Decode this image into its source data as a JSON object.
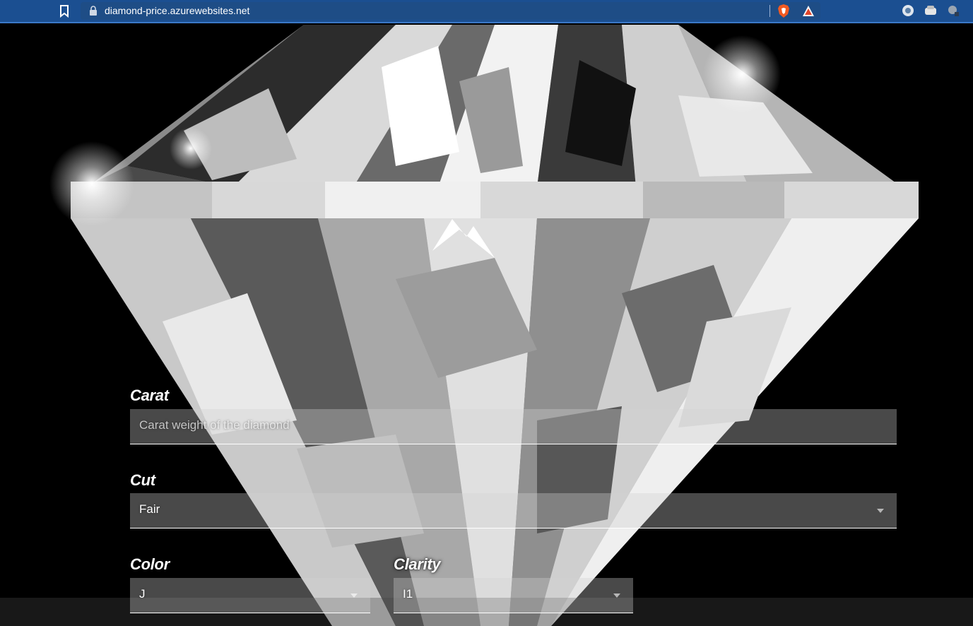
{
  "browser": {
    "url": "diamond-price.azurewebsites.net",
    "icons": [
      "bookmark-icon",
      "lock-icon",
      "brave-shield-icon",
      "brave-rewards-icon",
      "extension-icon",
      "extension-icon",
      "extension-icon"
    ]
  },
  "form": {
    "carat": {
      "label": "Carat",
      "placeholder": "Carat weight of the diamond"
    },
    "cut": {
      "label": "Cut",
      "value": "Fair"
    },
    "color": {
      "label": "Color",
      "value": "J"
    },
    "clarity": {
      "label": "Clarity",
      "value": "I1"
    }
  },
  "colors": {
    "topbar": "#1b4f91",
    "background": "#000000",
    "field_text": "#ffffff"
  }
}
